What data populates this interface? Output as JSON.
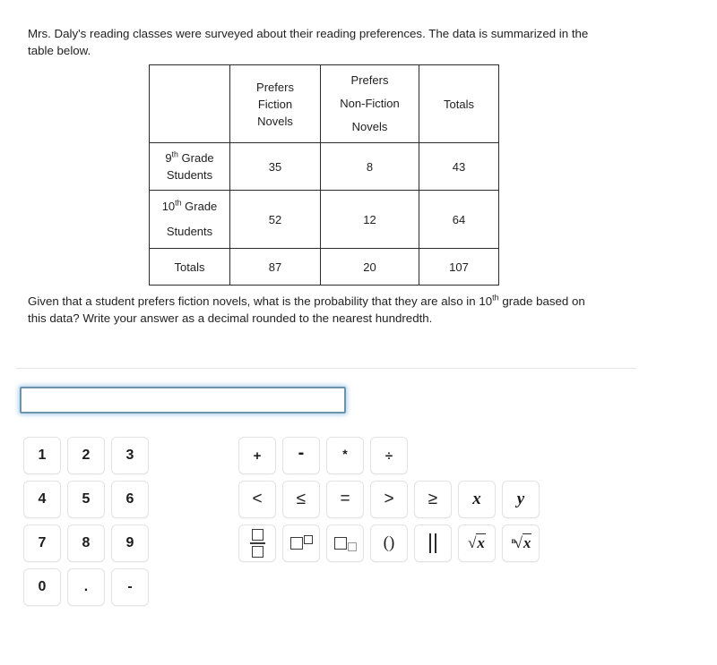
{
  "intro": {
    "text": "Mrs. Daly's reading classes were surveyed about their reading preferences. The data is summarized in the table below."
  },
  "table": {
    "corner_label": "",
    "columns": [
      {
        "id": "fiction",
        "lines": [
          "Prefers",
          "Fiction",
          "Novels"
        ]
      },
      {
        "id": "nonfiction",
        "lines": [
          "Prefers",
          "Non-Fiction",
          "Novels"
        ]
      },
      {
        "id": "totals",
        "lines": [
          "Totals"
        ]
      }
    ],
    "rows": [
      {
        "id": "grade-9",
        "label_number": "9",
        "label_ordinal": "th",
        "label_rest": " Grade",
        "label_line2": "Students",
        "fiction": "35",
        "nonfiction": "8",
        "totals": "43"
      },
      {
        "id": "grade-10",
        "label_number": "10",
        "label_ordinal": "th",
        "label_rest": " Grade",
        "label_line2": "Students",
        "fiction": "52",
        "nonfiction": "12",
        "totals": "64"
      },
      {
        "id": "totals",
        "label_plain": "Totals",
        "fiction": "87",
        "nonfiction": "20",
        "totals": "107"
      }
    ]
  },
  "question": {
    "part1": "Given that a student prefers fiction novels, what is the probability that they are also in 10",
    "ordinal": "th",
    "part2": " grade based on this data? Write your answer as a decimal rounded to the nearest hundredth."
  },
  "answer": {
    "value": "",
    "placeholder": ""
  },
  "number_pad": {
    "rows": [
      [
        "1",
        "2",
        "3"
      ],
      [
        "4",
        "5",
        "6"
      ],
      [
        "7",
        "8",
        "9"
      ],
      [
        "0",
        ".",
        "-"
      ]
    ]
  },
  "symbol_pad": {
    "operators": [
      {
        "name": "plus",
        "label": "+"
      },
      {
        "name": "minus",
        "label": "-"
      },
      {
        "name": "times",
        "label": "*"
      },
      {
        "name": "divide",
        "label": "÷"
      }
    ],
    "relations": [
      {
        "name": "less-than",
        "label": "<"
      },
      {
        "name": "less-than-or-equal",
        "label": "≤"
      },
      {
        "name": "equals",
        "label": "="
      },
      {
        "name": "greater-than",
        "label": ">"
      },
      {
        "name": "greater-than-or-equal",
        "label": "≥"
      },
      {
        "name": "variable-x",
        "label": "x"
      },
      {
        "name": "variable-y",
        "label": "y"
      }
    ],
    "structures": [
      {
        "name": "fraction",
        "label": "□/□"
      },
      {
        "name": "superscript",
        "label": "□^□"
      },
      {
        "name": "subscript",
        "label": "□_□"
      },
      {
        "name": "parentheses",
        "label": "()"
      },
      {
        "name": "absolute-value",
        "label": "||"
      },
      {
        "name": "square-root",
        "label": "√x"
      },
      {
        "name": "nth-root",
        "label": "ⁿ√x"
      }
    ]
  },
  "colors": {
    "input_border": "#6e94ad",
    "input_glow": "#82b9e1",
    "table_border": "#2b2b2b",
    "divider": "#e4e4e4",
    "key_border": "#e3e3e3",
    "text": "#1f1f1f"
  }
}
